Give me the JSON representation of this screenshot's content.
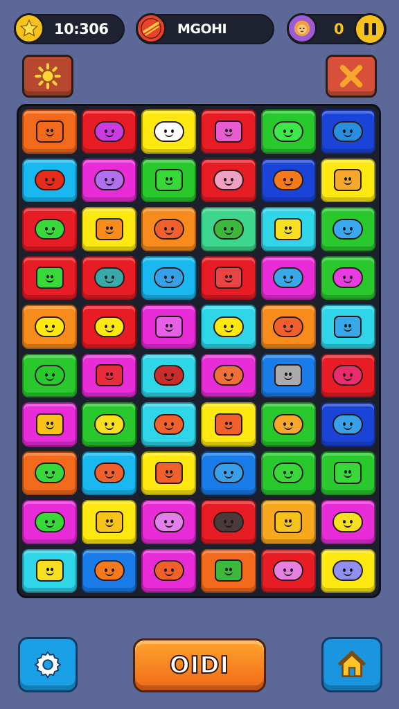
{
  "hud": {
    "time": "10:306",
    "player_name": "MGOHI",
    "score": "0",
    "icons": {
      "time": "star-coin-icon",
      "name": "ball-icon",
      "score": "lion-icon",
      "pause": "pause-icon"
    }
  },
  "top_buttons": {
    "left": "sun-icon",
    "right": "close-icon"
  },
  "bottom": {
    "play_label": "OIDI",
    "left_icon": "gear-icon",
    "right_icon": "home-icon"
  },
  "board": {
    "rows": 10,
    "cols": 6,
    "tiles": [
      [
        "#f46a1c",
        "#e81c24",
        "#fde910",
        "#e81c24",
        "#29c92e",
        "#1a44d8"
      ],
      [
        "#1ab8f0",
        "#e82cd8",
        "#29c92e",
        "#e81c24",
        "#1a44d8",
        "#fde910"
      ],
      [
        "#e81c24",
        "#fde910",
        "#f78c1c",
        "#3cd68c",
        "#2ed6e8",
        "#29c92e"
      ],
      [
        "#e81c24",
        "#e81c24",
        "#1ab8f0",
        "#e81c24",
        "#e82cd8",
        "#29c92e"
      ],
      [
        "#f78c1c",
        "#e81c24",
        "#e82cd8",
        "#2ed6e8",
        "#f78c1c",
        "#2ed6e8"
      ],
      [
        "#29c92e",
        "#e82cd8",
        "#2ed6e8",
        "#e82cd8",
        "#1a7ce8",
        "#e81c24"
      ],
      [
        "#e82cd8",
        "#29c92e",
        "#2ed6e8",
        "#fde910",
        "#29c92e",
        "#1a44d8"
      ],
      [
        "#f46a1c",
        "#1ab8f0",
        "#fde910",
        "#1a7ce8",
        "#29c92e",
        "#29c92e"
      ],
      [
        "#e82cd8",
        "#fde910",
        "#e82cd8",
        "#e81c24",
        "#f7a81c",
        "#e82cd8"
      ],
      [
        "#2ed6e8",
        "#1a7ce8",
        "#e82cd8",
        "#f46a1c",
        "#e81c24",
        "#fde910"
      ]
    ],
    "blobs": [
      [
        "#f46a1c",
        "#c83ce0",
        "#ffffff",
        "#e85cd0",
        "#3ce84c",
        "#2a8ee0"
      ],
      [
        "#e82c1c",
        "#b070f0",
        "#38d838",
        "#f0a0c0",
        "#f47a1c",
        "#f7a82c"
      ],
      [
        "#38d838",
        "#f78c1c",
        "#f0602c",
        "#3cb83c",
        "#f7e020",
        "#38a8f0"
      ],
      [
        "#38d838",
        "#38a8a8",
        "#38a0e8",
        "#e84444",
        "#38a8e8",
        "#e83ce0"
      ],
      [
        "#fde910",
        "#fde910",
        "#e860e8",
        "#fde910",
        "#f0602c",
        "#38a8e8"
      ],
      [
        "#29c92e",
        "#e82c3c",
        "#c82c2c",
        "#f0703c",
        "#aaaaaa",
        "#e82c6c"
      ],
      [
        "#f7c21a",
        "#f7e020",
        "#f0602c",
        "#f0602c",
        "#f7a82c",
        "#38a0e8"
      ],
      [
        "#38d838",
        "#f0602c",
        "#f0602c",
        "#38a0e8",
        "#38d838",
        "#38d838"
      ],
      [
        "#38d838",
        "#f7c21a",
        "#e080e8",
        "#4a3a3a",
        "#f7c21a",
        "#f7e020"
      ],
      [
        "#f7e020",
        "#f47a1c",
        "#f0602c",
        "#3cb83c",
        "#e880e0",
        "#9090f0"
      ]
    ]
  },
  "colors": {
    "background": "#5c6898",
    "board": "#1c1f2c",
    "accent": "#f7c21a"
  }
}
